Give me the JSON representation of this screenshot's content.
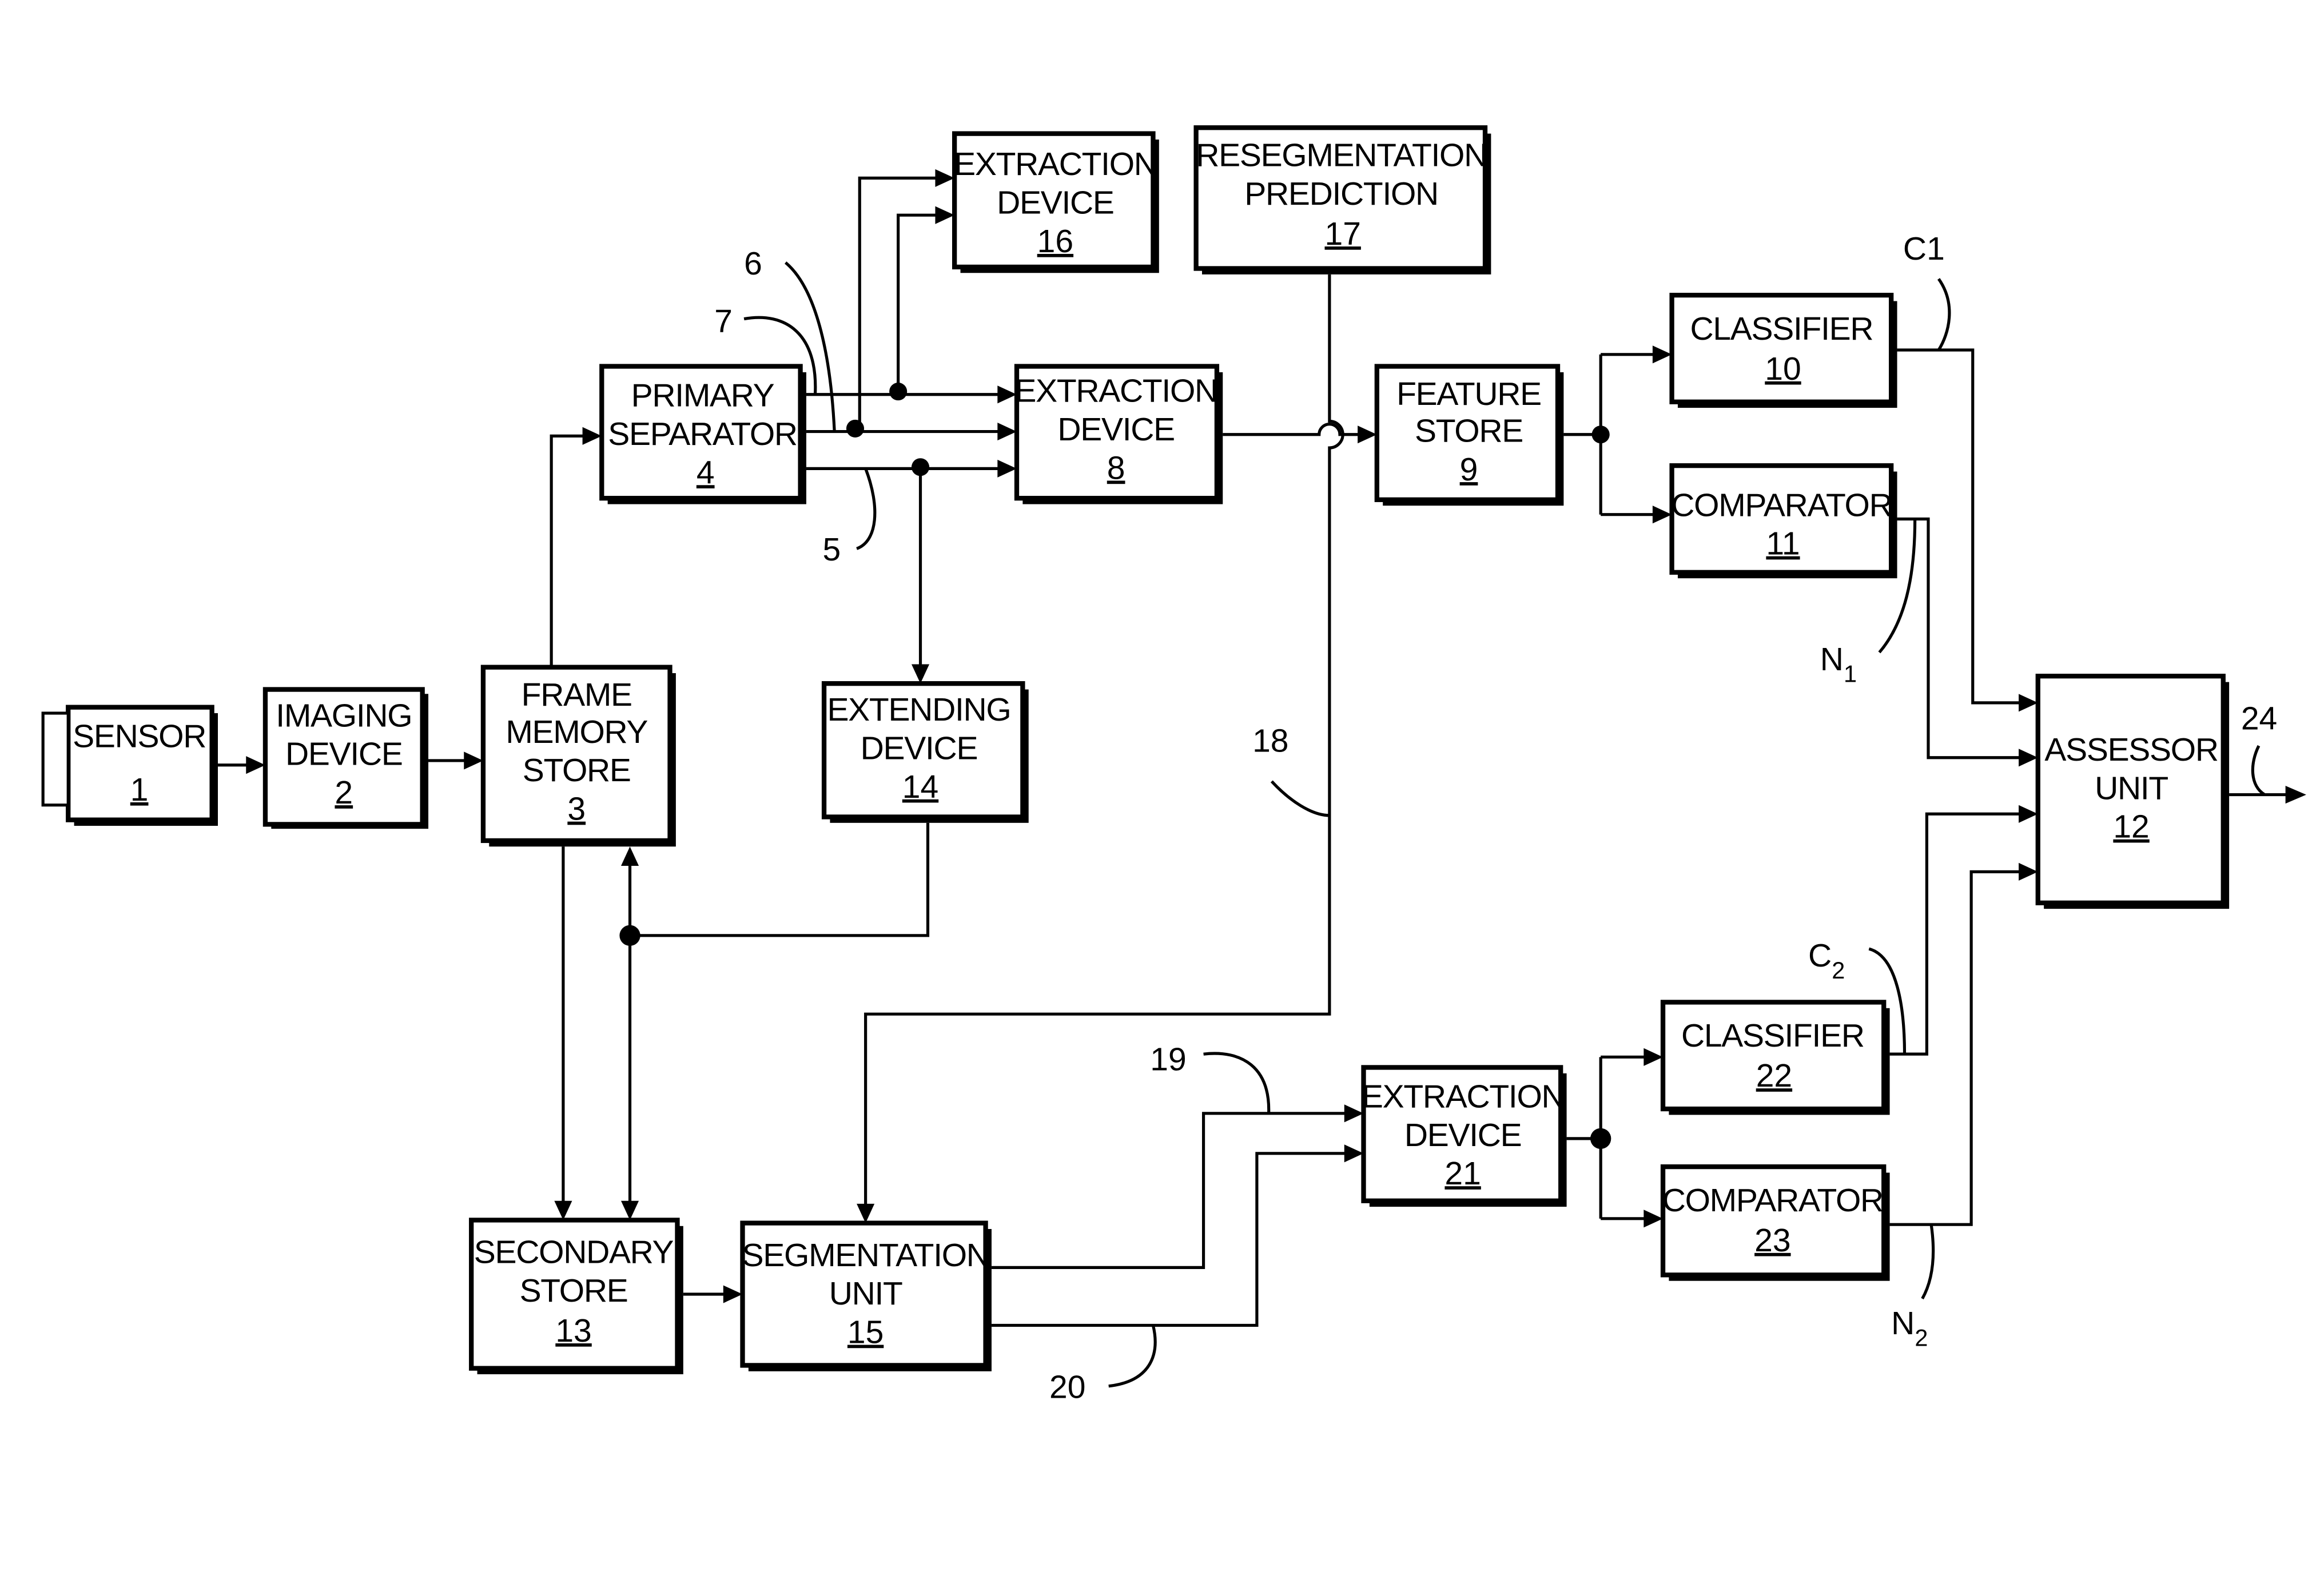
{
  "figure": {
    "boxes": [
      {
        "id": "sensor",
        "lines": [
          "SENSOR"
        ],
        "num": "1"
      },
      {
        "id": "imaging-device",
        "lines": [
          "IMAGING",
          "DEVICE"
        ],
        "num": "2"
      },
      {
        "id": "frame-memory-store",
        "lines": [
          "FRAME",
          "MEMORY",
          "STORE"
        ],
        "num": "3"
      },
      {
        "id": "primary-separator",
        "lines": [
          "PRIMARY",
          "SEPARATOR"
        ],
        "num": "4"
      },
      {
        "id": "extraction-device-8",
        "lines": [
          "EXTRACTION",
          "DEVICE"
        ],
        "num": "8"
      },
      {
        "id": "feature-store",
        "lines": [
          "FEATURE",
          "STORE"
        ],
        "num": "9"
      },
      {
        "id": "classifier-10",
        "lines": [
          "CLASSIFIER"
        ],
        "num": "10"
      },
      {
        "id": "comparator-11",
        "lines": [
          "COMPARATOR"
        ],
        "num": "11"
      },
      {
        "id": "assessor-unit",
        "lines": [
          "ASSESSOR",
          "UNIT"
        ],
        "num": "12"
      },
      {
        "id": "secondary-store",
        "lines": [
          "SECONDARY",
          "STORE"
        ],
        "num": "13"
      },
      {
        "id": "extending-device",
        "lines": [
          "EXTENDING",
          "DEVICE"
        ],
        "num": "14"
      },
      {
        "id": "segmentation-unit",
        "lines": [
          "SEGMENTATION",
          "UNIT"
        ],
        "num": "15"
      },
      {
        "id": "extraction-device-16",
        "lines": [
          "EXTRACTION",
          "DEVICE"
        ],
        "num": "16"
      },
      {
        "id": "resegmentation-prediction",
        "lines": [
          "RESEGMENTATION",
          "PREDICTION"
        ],
        "num": "17"
      },
      {
        "id": "extraction-device-21",
        "lines": [
          "EXTRACTION",
          "DEVICE"
        ],
        "num": "21"
      },
      {
        "id": "classifier-22",
        "lines": [
          "CLASSIFIER"
        ],
        "num": "22"
      },
      {
        "id": "comparator-23",
        "lines": [
          "COMPARATOR"
        ],
        "num": "23"
      }
    ],
    "refs": {
      "r5": "5",
      "r6": "6",
      "r7": "7",
      "r18": "18",
      "r19": "19",
      "r20": "20",
      "r24": "24",
      "c1": "C1",
      "c2_main": "C",
      "c2_sub": "2",
      "n1_main": "N",
      "n1_sub": "1",
      "n2_main": "N",
      "n2_sub": "2"
    }
  }
}
